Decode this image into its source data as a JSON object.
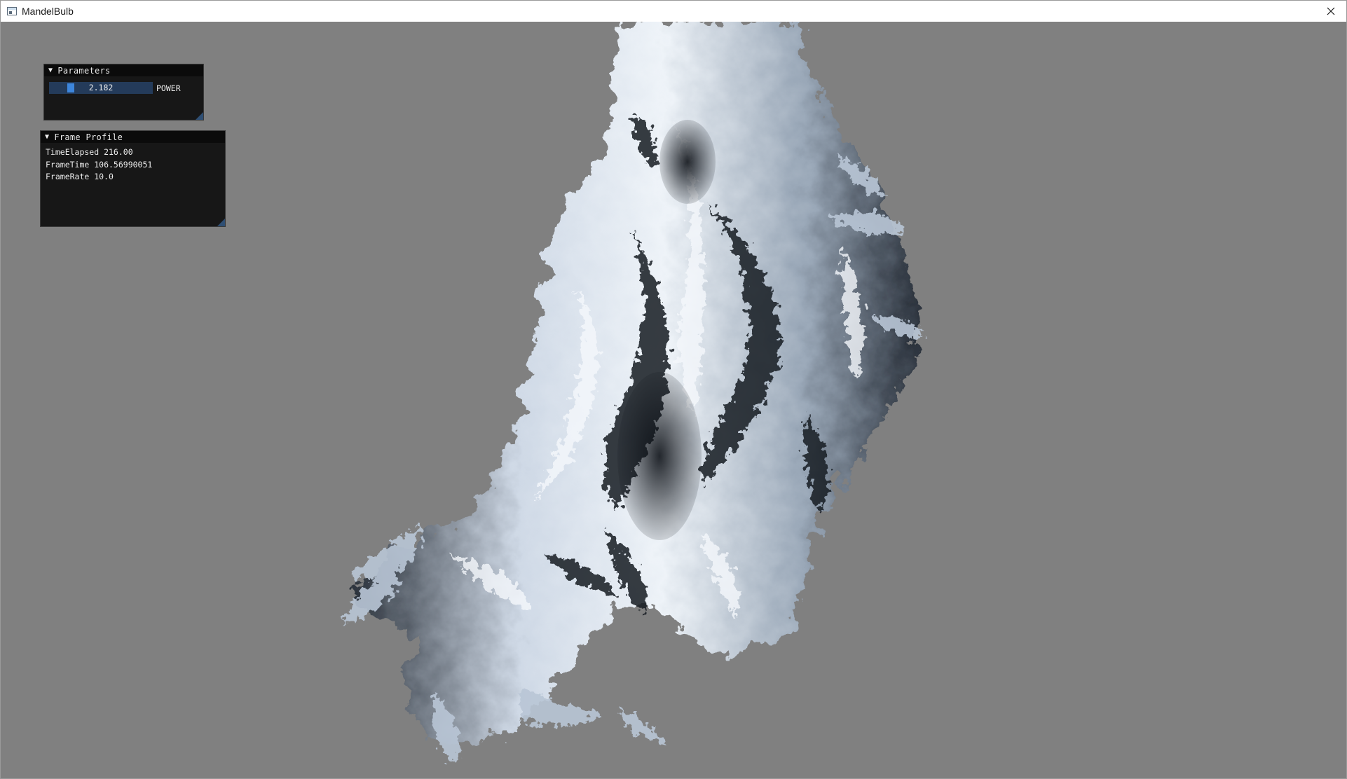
{
  "window": {
    "title": "MandelBulb",
    "close_glyph": "✕"
  },
  "icons": {
    "app": "window-app-icon",
    "close": "close-icon",
    "collapse": "collapse-arrow-icon"
  },
  "viewport": {
    "background_color": "#808080",
    "content": "mandelbulb-fractal-render"
  },
  "parameters_panel": {
    "title": "Parameters",
    "arrow": "▼",
    "power": {
      "label": "POWER",
      "value": "2.182",
      "accent_color": "#3d86dc",
      "track_color": "#243b5a"
    }
  },
  "frame_profile_panel": {
    "title": "Frame Profile",
    "arrow": "▼",
    "lines": [
      "TimeElapsed 216.00",
      "FrameTime 106.56990051",
      "FrameRate 10.0"
    ]
  }
}
